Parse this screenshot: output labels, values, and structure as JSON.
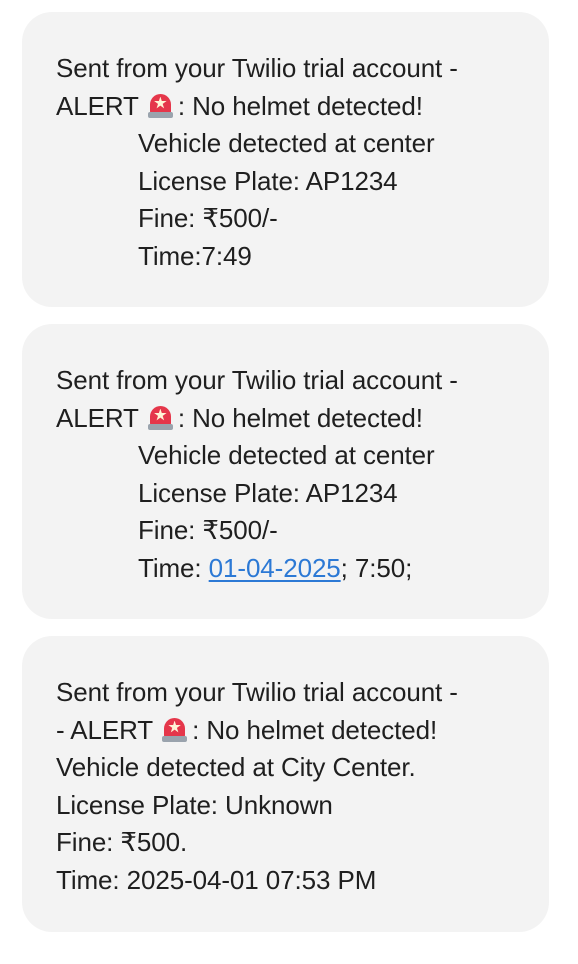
{
  "messages": [
    {
      "intro": "Sent from your Twilio trial account -",
      "alert_prefix": "ALERT",
      "icon": "police-light-siren-icon",
      "alert_text": ": No helmet detected!",
      "vehicle": "Vehicle detected at center",
      "plate": "License Plate: AP1234",
      "fine": "Fine: ₹500/-",
      "time": "Time:7:49"
    },
    {
      "intro": "Sent from your Twilio trial account -",
      "alert_prefix": "ALERT",
      "icon": "police-light-siren-icon",
      "alert_text": ": No helmet detected!",
      "vehicle": "Vehicle detected at center",
      "plate": "License Plate: AP1234",
      "fine": "Fine: ₹500/-",
      "time_prefix": "Time: ",
      "time_link": "01-04-2025",
      "time_suffix": "; 7:50;"
    },
    {
      "intro": "Sent from your Twilio trial account -",
      "alert_prefix": "- ALERT",
      "icon": "police-light-siren-icon",
      "alert_text": ": No helmet detected!",
      "vehicle": "Vehicle detected at City Center.",
      "plate": "License Plate: Unknown",
      "fine": "Fine: ₹500.",
      "time": "Time: 2025-04-01 07:53 PM"
    }
  ],
  "colors": {
    "bubble_background": "#f3f3f3",
    "text": "#1f1f1f",
    "link": "#2c79d5"
  }
}
